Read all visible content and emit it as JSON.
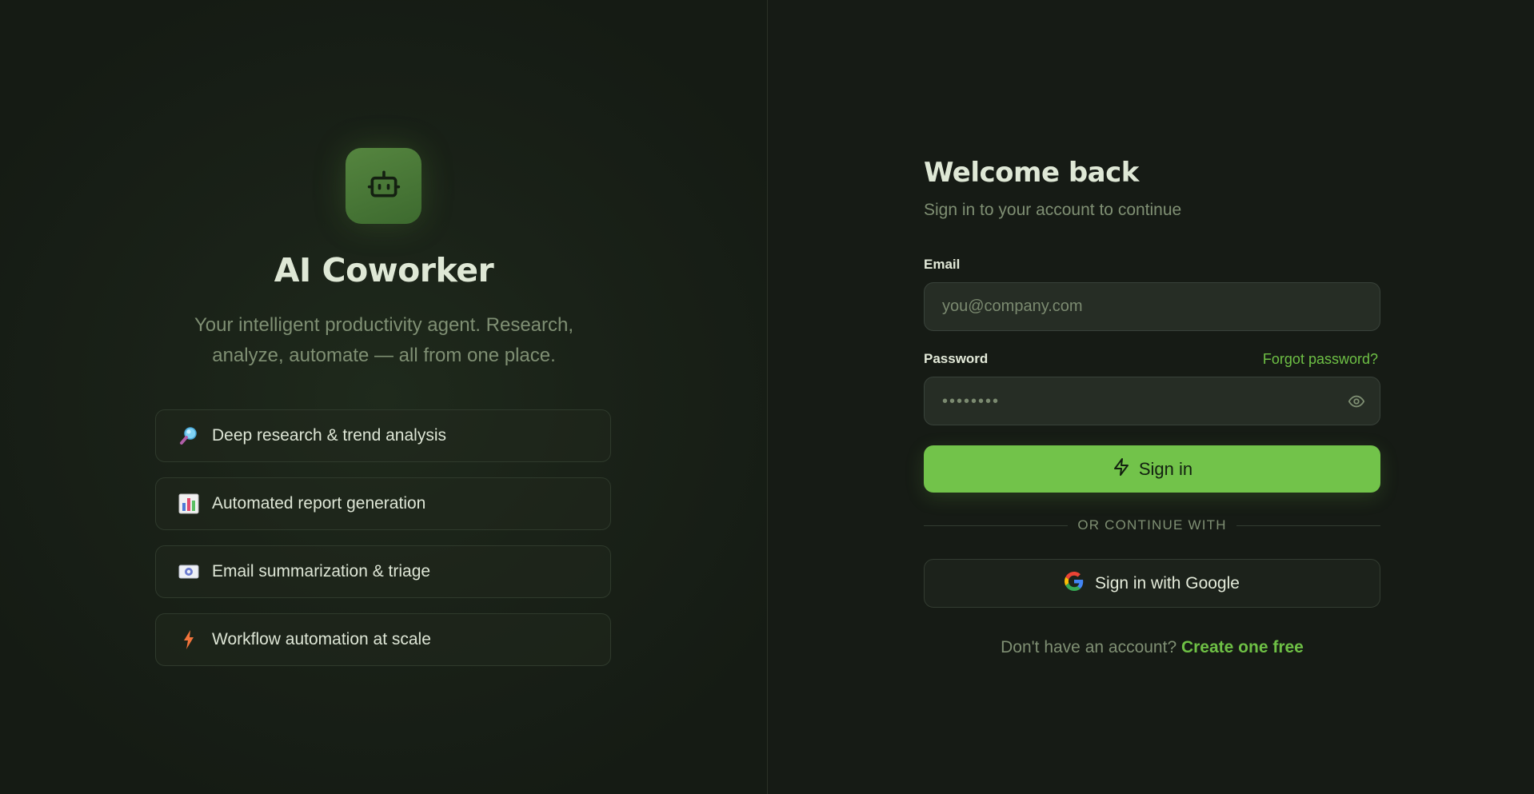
{
  "hero": {
    "logo_icon": "robot-icon",
    "title": "AI Coworker",
    "subtitle": "Your intelligent productivity agent. Research, analyze, automate — all from one place.",
    "features": [
      {
        "icon": "magnifier-icon",
        "label": "Deep research & trend analysis"
      },
      {
        "icon": "bar-chart-icon",
        "label": "Automated report generation"
      },
      {
        "icon": "email-icon",
        "label": "Email summarization & triage"
      },
      {
        "icon": "lightning-icon",
        "label": "Workflow automation at scale"
      }
    ]
  },
  "form": {
    "title": "Welcome back",
    "subtitle": "Sign in to your account to continue",
    "email": {
      "label": "Email",
      "placeholder": "you@company.com",
      "value": ""
    },
    "password": {
      "label": "Password",
      "masked_value": "••••••••",
      "forgot_label": "Forgot password?",
      "toggle_icon": "eye-icon"
    },
    "submit_label": "Sign in",
    "submit_icon": "lightning-icon",
    "divider_text": "OR CONTINUE WITH",
    "google_label": "Sign in with Google",
    "signup_prompt": "Don't have an account?",
    "signup_link": "Create one free"
  },
  "colors": {
    "accent": "#72c34a",
    "link": "#6ec045",
    "background": "#161b15",
    "muted_text": "#7f8f73"
  }
}
